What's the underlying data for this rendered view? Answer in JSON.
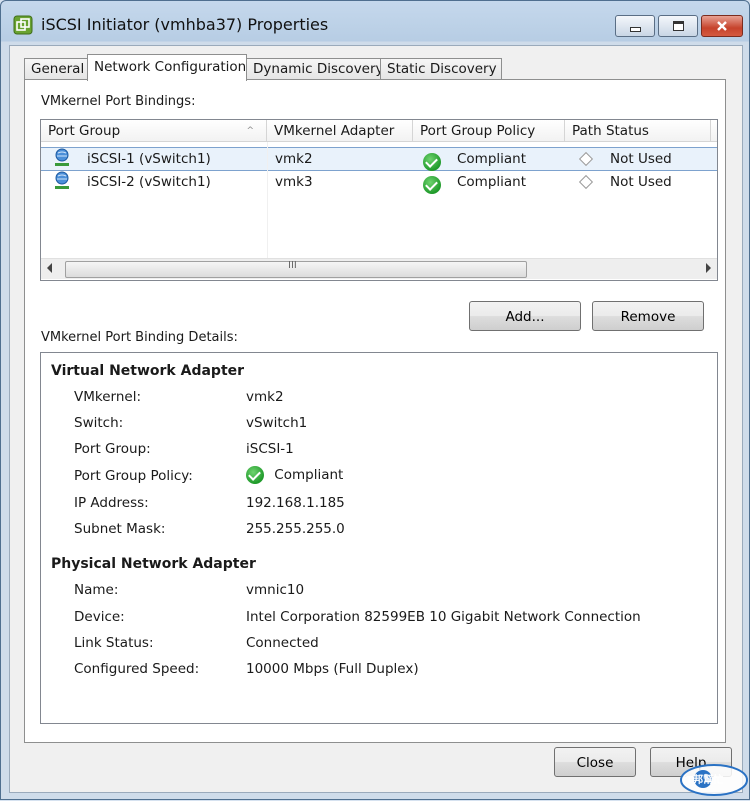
{
  "window": {
    "title": "iSCSI Initiator (vmhba37) Properties"
  },
  "tabs": [
    {
      "label": "General"
    },
    {
      "label": "Network Configuration"
    },
    {
      "label": "Dynamic Discovery"
    },
    {
      "label": "Static Discovery"
    }
  ],
  "bindings": {
    "section_label": "VMkernel Port Bindings:",
    "columns": [
      "Port Group",
      "VMkernel Adapter",
      "Port Group Policy",
      "Path Status"
    ],
    "rows": [
      {
        "port_group": "iSCSI-1 (vSwitch1)",
        "adapter": "vmk2",
        "policy": "Compliant",
        "path_status": "Not Used"
      },
      {
        "port_group": "iSCSI-2 (vSwitch1)",
        "adapter": "vmk3",
        "policy": "Compliant",
        "path_status": "Not Used"
      }
    ],
    "scroll_grip": "III",
    "add_label": "Add...",
    "remove_label": "Remove"
  },
  "details": {
    "section_label": "VMkernel Port Binding Details:",
    "virtual": {
      "heading": "Virtual Network Adapter",
      "rows": [
        {
          "key": "VMkernel:",
          "value": "vmk2"
        },
        {
          "key": "Switch:",
          "value": "vSwitch1"
        },
        {
          "key": "Port Group:",
          "value": "iSCSI-1"
        },
        {
          "key": "Port Group Policy:",
          "value": "Compliant"
        },
        {
          "key": "IP Address:",
          "value": "192.168.1.185"
        },
        {
          "key": "Subnet Mask:",
          "value": "255.255.255.0"
        }
      ]
    },
    "physical": {
      "heading": "Physical Network Adapter",
      "rows": [
        {
          "key": "Name:",
          "value": "vmnic10"
        },
        {
          "key": "Device:",
          "value": "Intel Corporation 82599EB 10 Gigabit Network Connection"
        },
        {
          "key": "Link Status:",
          "value": "Connected"
        },
        {
          "key": "Configured Speed:",
          "value": "10000 Mbps (Full Duplex)"
        }
      ]
    }
  },
  "footer": {
    "close_label": "Close",
    "help_label": "Help"
  },
  "watermark": {
    "text": "iT邦幫忙"
  },
  "colors": {
    "compliant": "#1f9a2a",
    "selection": "#e9f2fb",
    "titlebar": "#b7cde4"
  }
}
